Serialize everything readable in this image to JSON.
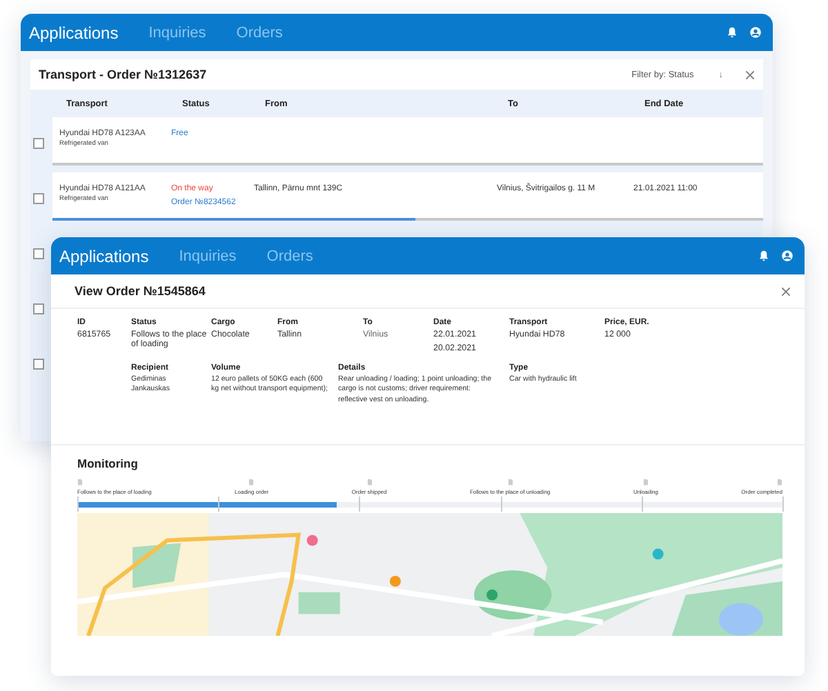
{
  "back_window": {
    "nav": [
      {
        "label": "Applications",
        "selected": true
      },
      {
        "label": "Inquiries",
        "selected": false
      },
      {
        "label": "Orders",
        "selected": false
      }
    ],
    "title": "Transport - Order №1312637",
    "filter": "Filter by: Status",
    "sort": "↓",
    "columns": [
      "Transport",
      "Status",
      "From",
      "To",
      "End Date"
    ],
    "rows": [
      {
        "checked": false,
        "vehicle": "Hyundai HD78 A123AA",
        "type": "Refrigerated van",
        "status": "Free",
        "color": "#2b7bd0"
      },
      {
        "checked": false,
        "vehicle": "Hyundai HD78 A121AA",
        "type": "Refrigerated van",
        "status": "On the way",
        "color": "#f0413a",
        "order": "Order №8234562",
        "from": "Tallinn, Pärnu mnt 139C",
        "to": "Vilnius, Švitrigailos g. 11 M",
        "end_date": "21.01.2021 11:00",
        "level": 0.51
      },
      {
        "checked": false
      },
      {
        "checked": false
      },
      {
        "checked": false
      }
    ]
  },
  "front_window": {
    "nav": [
      {
        "label": "Applications",
        "selected": true
      },
      {
        "label": "Inquiries",
        "selected": false
      },
      {
        "label": "Orders",
        "selected": false
      }
    ],
    "title": "View Order №1545864",
    "fields": [
      {
        "label": "ID",
        "values": [
          "6815765"
        ]
      },
      {
        "label": "Status",
        "values": [
          "Follows to the place of loading"
        ]
      },
      {
        "label": "Cargo",
        "values": [
          "Chocolate"
        ]
      },
      {
        "label": "From",
        "values": [
          "Tallinn"
        ]
      },
      {
        "label": "To",
        "values": [
          "Vilnius"
        ]
      },
      {
        "label": "Date",
        "values": [
          "22.01.2021",
          "20.02.2021"
        ]
      },
      {
        "label": "Transport",
        "values": [
          "Hyundai HD78"
        ]
      },
      {
        "label": "Price, EUR.",
        "values": [
          "12 000"
        ]
      }
    ],
    "details": [
      {
        "label": "Recipient",
        "text": "Gediminas Jankauskas"
      },
      {
        "label": "Volume",
        "text": "12 euro pallets of 50KG each (600 kg net without transport equipment);"
      },
      {
        "label": "Details",
        "text": "Rear unloading / loading; 1 point unloading; the cargo is not customs; driver requirement: reflective vest on unloading."
      },
      {
        "label": "Type",
        "text": "Car with hydraulic lift"
      }
    ],
    "monitoring": {
      "title": "Monitoring",
      "steps": [
        "Follows to the place of loading",
        "Loading order",
        "Order shipped",
        "Follows to the place of unloading",
        "Unloading",
        "Order completed"
      ],
      "level": 0.367
    }
  }
}
